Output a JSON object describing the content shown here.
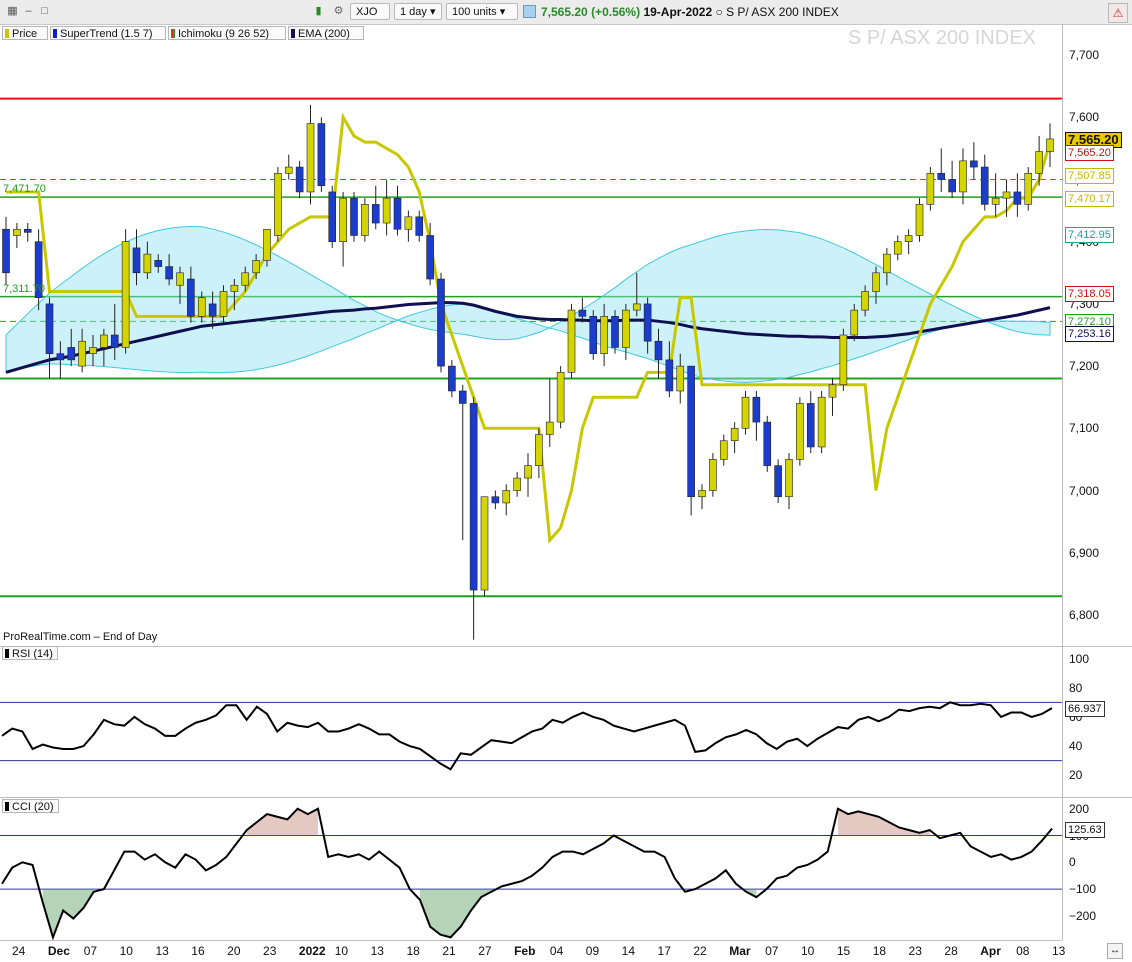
{
  "toolbar": {
    "symbol": "XJO",
    "interval": "1 day",
    "units": "100 units",
    "last_price": "7,565.20",
    "change": "(+0.56%)",
    "date": "19-Apr-2022",
    "instrument": "S P/ ASX 200 INDEX"
  },
  "watermark": "S P/ ASX 200 INDEX",
  "credit": "ProRealTime.com – End of Day",
  "legend": [
    {
      "label": "Price",
      "color": "#c8c800"
    },
    {
      "label": "SuperTrend (1.5 7)",
      "color": "#1020c8"
    },
    {
      "label": "Ichimoku (9 26 52)",
      "color": "#e03020"
    },
    {
      "label": "EMA (200)",
      "color": "#101050"
    }
  ],
  "price_axis": {
    "ticks": [
      "7,700",
      "7,600",
      "7,500",
      "7,400",
      "7,300",
      "7,200",
      "7,100",
      "7,000",
      "6,900",
      "6,800"
    ],
    "values": [
      7700,
      7600,
      7500,
      7400,
      7300,
      7200,
      7100,
      7000,
      6900,
      6800
    ],
    "range": [
      6750,
      7750
    ]
  },
  "price_tags": [
    {
      "text": "7,565.20",
      "value": 7565.2,
      "color": "#111111",
      "bg": "#e8c800",
      "bold": true
    },
    {
      "text": "7,565.20",
      "value": 7545,
      "color": "#d01010",
      "bg": "#ffffff"
    },
    {
      "text": "7,507.85",
      "value": 7507.85,
      "color": "#c8b400",
      "bg": "#ffffff"
    },
    {
      "text": "7,470.17",
      "value": 7470.17,
      "color": "#c8b400",
      "bg": "#ffffff"
    },
    {
      "text": "7,412.95",
      "value": 7412.95,
      "color": "#20a0a0",
      "bg": "#ffffff"
    },
    {
      "text": "7,318.05",
      "value": 7318.05,
      "color": "#d01010",
      "bg": "#ffffff"
    },
    {
      "text": "7,272.10",
      "value": 7272.1,
      "color": "#20a020",
      "bg": "#ffffff"
    },
    {
      "text": "7,253.16",
      "value": 7253.16,
      "color": "#101050",
      "bg": "#ffffff"
    }
  ],
  "left_labels": [
    {
      "text": "7,471.70",
      "value": 7471.7,
      "color": "#20a020"
    },
    {
      "text": "7,311.70",
      "value": 7311.7,
      "color": "#20a020"
    }
  ],
  "x_axis": {
    "labels": [
      "24",
      "Dec",
      "07",
      "10",
      "13",
      "16",
      "20",
      "23",
      "2022",
      "10",
      "13",
      "18",
      "21",
      "27",
      "Feb",
      "04",
      "09",
      "14",
      "17",
      "22",
      "Mar",
      "07",
      "10",
      "15",
      "18",
      "23",
      "28",
      "Apr",
      "08",
      "13"
    ]
  },
  "rsi": {
    "label": "RSI (14)",
    "ticks": [
      "100",
      "80",
      "60",
      "40",
      "20"
    ],
    "values": [
      100,
      80,
      60,
      40,
      20
    ],
    "last": "66.937",
    "upper": 70,
    "lower": 30,
    "series": [
      47,
      52,
      50,
      38,
      41,
      39,
      38,
      38,
      40,
      48,
      58,
      55,
      54,
      60,
      55,
      52,
      47,
      47,
      52,
      56,
      58,
      61,
      68,
      68,
      58,
      67,
      62,
      50,
      56,
      54,
      53,
      56,
      50,
      50,
      52,
      55,
      52,
      48,
      48,
      43,
      40,
      38,
      33,
      28,
      24,
      35,
      34,
      39,
      44,
      43,
      42,
      46,
      50,
      52,
      58,
      56,
      60,
      63,
      60,
      58,
      54,
      52,
      50,
      52,
      54,
      56,
      58,
      54,
      36,
      37,
      42,
      46,
      48,
      51,
      48,
      42,
      38,
      43,
      45,
      40,
      45,
      49,
      53,
      52,
      58,
      60,
      57,
      60,
      65,
      64,
      66,
      67,
      66,
      70,
      68,
      68,
      69,
      68,
      60,
      63,
      63,
      60,
      62,
      66
    ],
    "colors": {
      "line": "#000000",
      "band": "#3030a0"
    }
  },
  "cci": {
    "label": "CCI (20)",
    "ticks": [
      "200",
      "100",
      "0",
      "−100",
      "−200"
    ],
    "values": [
      200,
      100,
      0,
      -100,
      -200
    ],
    "last": "125.63",
    "series": [
      -80,
      -20,
      0,
      -10,
      -150,
      -280,
      -180,
      -210,
      -170,
      -110,
      -100,
      -30,
      40,
      40,
      10,
      30,
      0,
      -20,
      30,
      10,
      -30,
      -10,
      20,
      70,
      120,
      150,
      180,
      170,
      160,
      200,
      180,
      200,
      20,
      30,
      20,
      30,
      10,
      40,
      10,
      -20,
      -100,
      -140,
      -240,
      -270,
      -280,
      -240,
      -180,
      -130,
      -110,
      -90,
      -80,
      -70,
      -50,
      -20,
      20,
      40,
      40,
      30,
      50,
      70,
      100,
      80,
      60,
      40,
      40,
      20,
      -60,
      -110,
      -100,
      -80,
      -60,
      -30,
      -80,
      -110,
      -130,
      -100,
      -60,
      -50,
      -20,
      -10,
      10,
      40,
      200,
      180,
      190,
      180,
      170,
      150,
      130,
      120,
      110,
      120,
      90,
      100,
      110,
      60,
      40,
      20,
      30,
      10,
      20,
      40,
      80,
      125.63
    ],
    "colors": {
      "line": "#000000",
      "pos_fill": "#c08878",
      "neg_fill": "#5aa060",
      "band": "#3030a0"
    }
  },
  "chart_data": {
    "type": "candlestick",
    "title": "S P/ ASX 200 INDEX",
    "ylim": [
      6750,
      7750
    ],
    "ohlc": [
      [
        7420,
        7440,
        7330,
        7350
      ],
      [
        7410,
        7430,
        7390,
        7420
      ],
      [
        7420,
        7430,
        7400,
        7415
      ],
      [
        7400,
        7420,
        7290,
        7310
      ],
      [
        7300,
        7310,
        7180,
        7220
      ],
      [
        7220,
        7240,
        7180,
        7210
      ],
      [
        7230,
        7260,
        7200,
        7210
      ],
      [
        7200,
        7260,
        7190,
        7240
      ],
      [
        7220,
        7250,
        7200,
        7230
      ],
      [
        7230,
        7260,
        7200,
        7250
      ],
      [
        7250,
        7300,
        7210,
        7230
      ],
      [
        7230,
        7420,
        7220,
        7400
      ],
      [
        7390,
        7420,
        7330,
        7350
      ],
      [
        7350,
        7400,
        7340,
        7380
      ],
      [
        7370,
        7380,
        7350,
        7360
      ],
      [
        7360,
        7380,
        7330,
        7340
      ],
      [
        7330,
        7360,
        7300,
        7350
      ],
      [
        7340,
        7360,
        7270,
        7280
      ],
      [
        7280,
        7320,
        7270,
        7310
      ],
      [
        7300,
        7320,
        7260,
        7280
      ],
      [
        7280,
        7330,
        7270,
        7320
      ],
      [
        7320,
        7340,
        7290,
        7330
      ],
      [
        7330,
        7360,
        7320,
        7350
      ],
      [
        7350,
        7380,
        7340,
        7370
      ],
      [
        7370,
        7420,
        7360,
        7420
      ],
      [
        7410,
        7520,
        7400,
        7510
      ],
      [
        7510,
        7540,
        7500,
        7520
      ],
      [
        7520,
        7530,
        7470,
        7480
      ],
      [
        7480,
        7620,
        7460,
        7590
      ],
      [
        7590,
        7600,
        7480,
        7490
      ],
      [
        7480,
        7490,
        7390,
        7400
      ],
      [
        7400,
        7480,
        7360,
        7470
      ],
      [
        7470,
        7480,
        7400,
        7410
      ],
      [
        7410,
        7470,
        7400,
        7460
      ],
      [
        7460,
        7490,
        7420,
        7430
      ],
      [
        7430,
        7500,
        7410,
        7470
      ],
      [
        7470,
        7490,
        7410,
        7420
      ],
      [
        7420,
        7450,
        7400,
        7440
      ],
      [
        7440,
        7450,
        7400,
        7410
      ],
      [
        7410,
        7430,
        7330,
        7340
      ],
      [
        7340,
        7350,
        7190,
        7200
      ],
      [
        7200,
        7210,
        7150,
        7160
      ],
      [
        7160,
        7170,
        6920,
        7140
      ],
      [
        7140,
        7150,
        6760,
        6840
      ],
      [
        6840,
        6990,
        6830,
        6990
      ],
      [
        6990,
        7000,
        6970,
        6980
      ],
      [
        6980,
        7010,
        6960,
        7000
      ],
      [
        7000,
        7030,
        6990,
        7020
      ],
      [
        7020,
        7060,
        6990,
        7040
      ],
      [
        7040,
        7100,
        7020,
        7090
      ],
      [
        7090,
        7180,
        7070,
        7110
      ],
      [
        7110,
        7200,
        7100,
        7190
      ],
      [
        7190,
        7300,
        7180,
        7290
      ],
      [
        7290,
        7310,
        7270,
        7280
      ],
      [
        7280,
        7290,
        7210,
        7220
      ],
      [
        7220,
        7300,
        7200,
        7280
      ],
      [
        7280,
        7290,
        7220,
        7230
      ],
      [
        7230,
        7300,
        7210,
        7290
      ],
      [
        7290,
        7350,
        7280,
        7300
      ],
      [
        7300,
        7310,
        7220,
        7240
      ],
      [
        7240,
        7260,
        7180,
        7210
      ],
      [
        7210,
        7240,
        7150,
        7160
      ],
      [
        7160,
        7220,
        7140,
        7200
      ],
      [
        7200,
        7200,
        6960,
        6990
      ],
      [
        6990,
        7010,
        6970,
        7000
      ],
      [
        7000,
        7060,
        6990,
        7050
      ],
      [
        7050,
        7090,
        7040,
        7080
      ],
      [
        7080,
        7110,
        7060,
        7100
      ],
      [
        7100,
        7160,
        7090,
        7150
      ],
      [
        7150,
        7160,
        7080,
        7110
      ],
      [
        7110,
        7120,
        7030,
        7040
      ],
      [
        7040,
        7050,
        6980,
        6990
      ],
      [
        6990,
        7060,
        6970,
        7050
      ],
      [
        7050,
        7150,
        7040,
        7140
      ],
      [
        7140,
        7160,
        7060,
        7070
      ],
      [
        7070,
        7160,
        7060,
        7150
      ],
      [
        7150,
        7180,
        7120,
        7170
      ],
      [
        7170,
        7260,
        7160,
        7250
      ],
      [
        7250,
        7300,
        7240,
        7290
      ],
      [
        7290,
        7330,
        7280,
        7320
      ],
      [
        7320,
        7360,
        7300,
        7350
      ],
      [
        7350,
        7390,
        7330,
        7380
      ],
      [
        7380,
        7410,
        7370,
        7400
      ],
      [
        7400,
        7420,
        7380,
        7410
      ],
      [
        7410,
        7470,
        7400,
        7460
      ],
      [
        7460,
        7520,
        7450,
        7510
      ],
      [
        7510,
        7550,
        7480,
        7500
      ],
      [
        7500,
        7530,
        7470,
        7480
      ],
      [
        7480,
        7550,
        7460,
        7530
      ],
      [
        7530,
        7560,
        7500,
        7520
      ],
      [
        7520,
        7540,
        7450,
        7460
      ],
      [
        7460,
        7510,
        7440,
        7470
      ],
      [
        7470,
        7500,
        7440,
        7480
      ],
      [
        7480,
        7510,
        7440,
        7460
      ],
      [
        7460,
        7520,
        7450,
        7510
      ],
      [
        7510,
        7570,
        7490,
        7545
      ],
      [
        7545,
        7590,
        7520,
        7565.2
      ]
    ],
    "hlines": [
      {
        "value": 7630,
        "color": "#e01010",
        "width": 2,
        "dash": ""
      },
      {
        "value": 7500,
        "color": "#20a020",
        "width": 1,
        "dash": "6 4"
      },
      {
        "value": 7471.7,
        "color": "#20a020",
        "width": 1.5,
        "dash": ""
      },
      {
        "value": 7311.7,
        "color": "#20a020",
        "width": 1.5,
        "dash": ""
      },
      {
        "value": 7272,
        "color": "#20a020",
        "width": 1,
        "dash": "6 4"
      },
      {
        "value": 7180,
        "color": "#20a020",
        "width": 2,
        "dash": ""
      },
      {
        "value": 6830,
        "color": "#20a020",
        "width": 2,
        "dash": ""
      }
    ],
    "ema200": [
      7190,
      7195,
      7200,
      7205,
      7210,
      7213,
      7216,
      7220,
      7224,
      7228,
      7232,
      7236,
      7240,
      7244,
      7248,
      7252,
      7256,
      7260,
      7264,
      7266,
      7268,
      7270,
      7272,
      7274,
      7276,
      7278,
      7280,
      7282,
      7284,
      7286,
      7288,
      7289,
      7290,
      7292,
      7293,
      7295,
      7297,
      7299,
      7300,
      7301,
      7302,
      7302,
      7301,
      7298,
      7293,
      7288,
      7284,
      7280,
      7278,
      7276,
      7275,
      7275,
      7274,
      7274,
      7273,
      7273,
      7273,
      7274,
      7274,
      7274,
      7272,
      7270,
      7267,
      7263,
      7260,
      7258,
      7256,
      7254,
      7252,
      7251,
      7250,
      7249,
      7248,
      7248,
      7247,
      7247,
      7246,
      7246,
      7246,
      7246,
      7247,
      7248,
      7250,
      7252,
      7255,
      7258,
      7261,
      7264,
      7267,
      7270,
      7273,
      7276,
      7279,
      7282,
      7286,
      7290,
      7294,
      7297,
      7300,
      7303,
      7305,
      7253.16
    ],
    "supertrend": [
      7480,
      7480,
      7480,
      7480,
      7320,
      7320,
      7320,
      7320,
      7320,
      7320,
      7320,
      7320,
      7280,
      7280,
      7280,
      7280,
      7280,
      7280,
      7280,
      7280,
      7280,
      7300,
      7320,
      7350,
      7380,
      7400,
      7420,
      7430,
      7440,
      7440,
      7440,
      7600,
      7570,
      7560,
      7560,
      7550,
      7540,
      7520,
      7480,
      7400,
      7300,
      7250,
      7200,
      7150,
      7100,
      7100,
      7100,
      7100,
      7100,
      7100,
      6920,
      6940,
      7000,
      7100,
      7150,
      7150,
      7150,
      7150,
      7150,
      7190,
      7190,
      7190,
      7310,
      7310,
      7170,
      7170,
      7170,
      7170,
      7170,
      7170,
      7170,
      7170,
      7170,
      7170,
      7170,
      7170,
      7170,
      7170,
      7170,
      7170,
      7000,
      7100,
      7150,
      7200,
      7250,
      7300,
      7330,
      7360,
      7400,
      7420,
      7440,
      7440,
      7450,
      7470,
      7470,
      7500,
      7560,
      7560,
      7560,
      7560,
      7560,
      7470
    ]
  }
}
